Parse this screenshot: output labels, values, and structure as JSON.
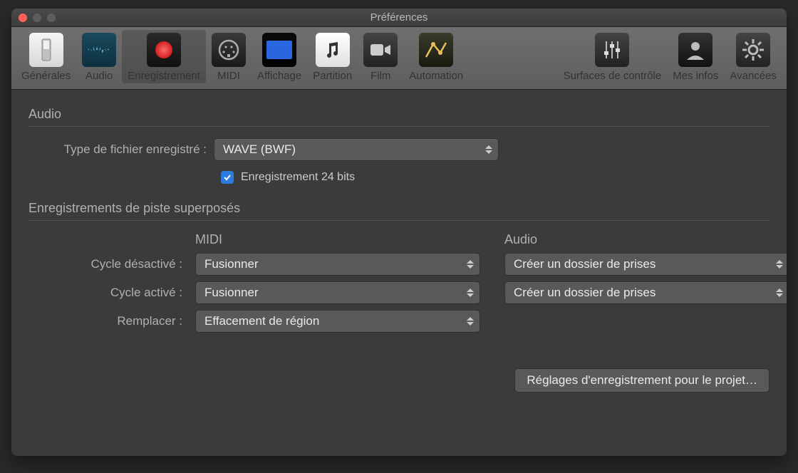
{
  "window": {
    "title": "Préférences"
  },
  "toolbar": {
    "items": [
      {
        "id": "general",
        "label": "Générales"
      },
      {
        "id": "audio",
        "label": "Audio"
      },
      {
        "id": "recording",
        "label": "Enregistrement"
      },
      {
        "id": "midi",
        "label": "MIDI"
      },
      {
        "id": "display",
        "label": "Affichage"
      },
      {
        "id": "score",
        "label": "Partition"
      },
      {
        "id": "film",
        "label": "Film"
      },
      {
        "id": "automation",
        "label": "Automation"
      },
      {
        "id": "surfaces",
        "label": "Surfaces de contrôle"
      },
      {
        "id": "myinfo",
        "label": "Mes infos"
      },
      {
        "id": "advanced",
        "label": "Avancées"
      }
    ],
    "selected": "recording"
  },
  "audio_section": {
    "title": "Audio",
    "file_type_label": "Type de fichier enregistré :",
    "file_type_value": "WAVE (BWF)",
    "bit_depth_checkbox": {
      "label": "Enregistrement 24 bits",
      "checked": true
    }
  },
  "overlap_section": {
    "title": "Enregistrements de piste superposés",
    "col_midi": "MIDI",
    "col_audio": "Audio",
    "rows": {
      "cycle_off": {
        "label": "Cycle désactivé :",
        "midi": "Fusionner",
        "audio": "Créer un dossier de prises"
      },
      "cycle_on": {
        "label": "Cycle activé :",
        "midi": "Fusionner",
        "audio": "Créer un dossier de prises"
      },
      "replace": {
        "label": "Remplacer :",
        "midi": "Effacement de région"
      }
    }
  },
  "footer": {
    "project_recording_settings_label": "Réglages d'enregistrement pour le projet…"
  }
}
